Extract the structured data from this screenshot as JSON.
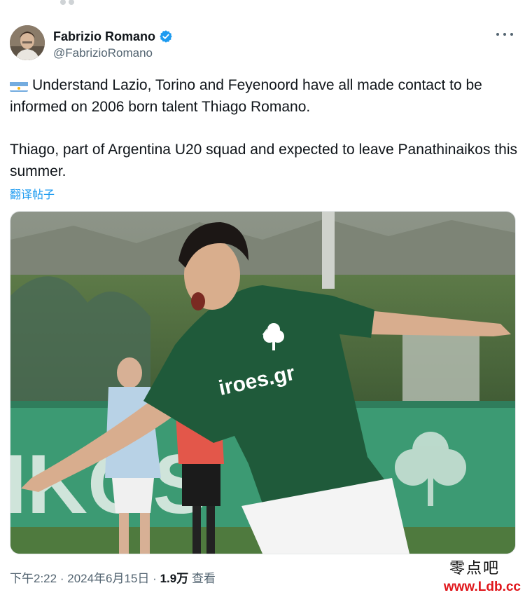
{
  "author": {
    "name": "Fabrizio Romano",
    "handle": "@FabrizioRomano",
    "verified": true,
    "avatar": "avatar-photo"
  },
  "menu_icon": "more-horizontal-icon",
  "tweet": {
    "flag": "argentina-flag-icon",
    "paragraph_1": "Understand Lazio, Torino and Feyenoord have all made contact to be informed on 2006 born talent Thiago Romano.",
    "paragraph_2": "Thiago, part of Argentina U20 squad and expected to leave Panathinaikos this summer."
  },
  "translate_label": "翻译帖子",
  "media": {
    "description": "football-player-celebrating-photo",
    "shirt_sponsor": "iroes.gr",
    "board_text": "IKOS"
  },
  "meta": {
    "time": "下午2:22",
    "separator": "·",
    "date": "2024年6月15日",
    "views_count": "1.9万",
    "views_label": "查看"
  },
  "watermark": {
    "cn": "零点吧",
    "url": "www.Ldb.cc"
  },
  "colors": {
    "accent": "#1d9bf0",
    "text": "#0f1419",
    "secondary": "#536471",
    "watermark_red": "#e0161b"
  }
}
